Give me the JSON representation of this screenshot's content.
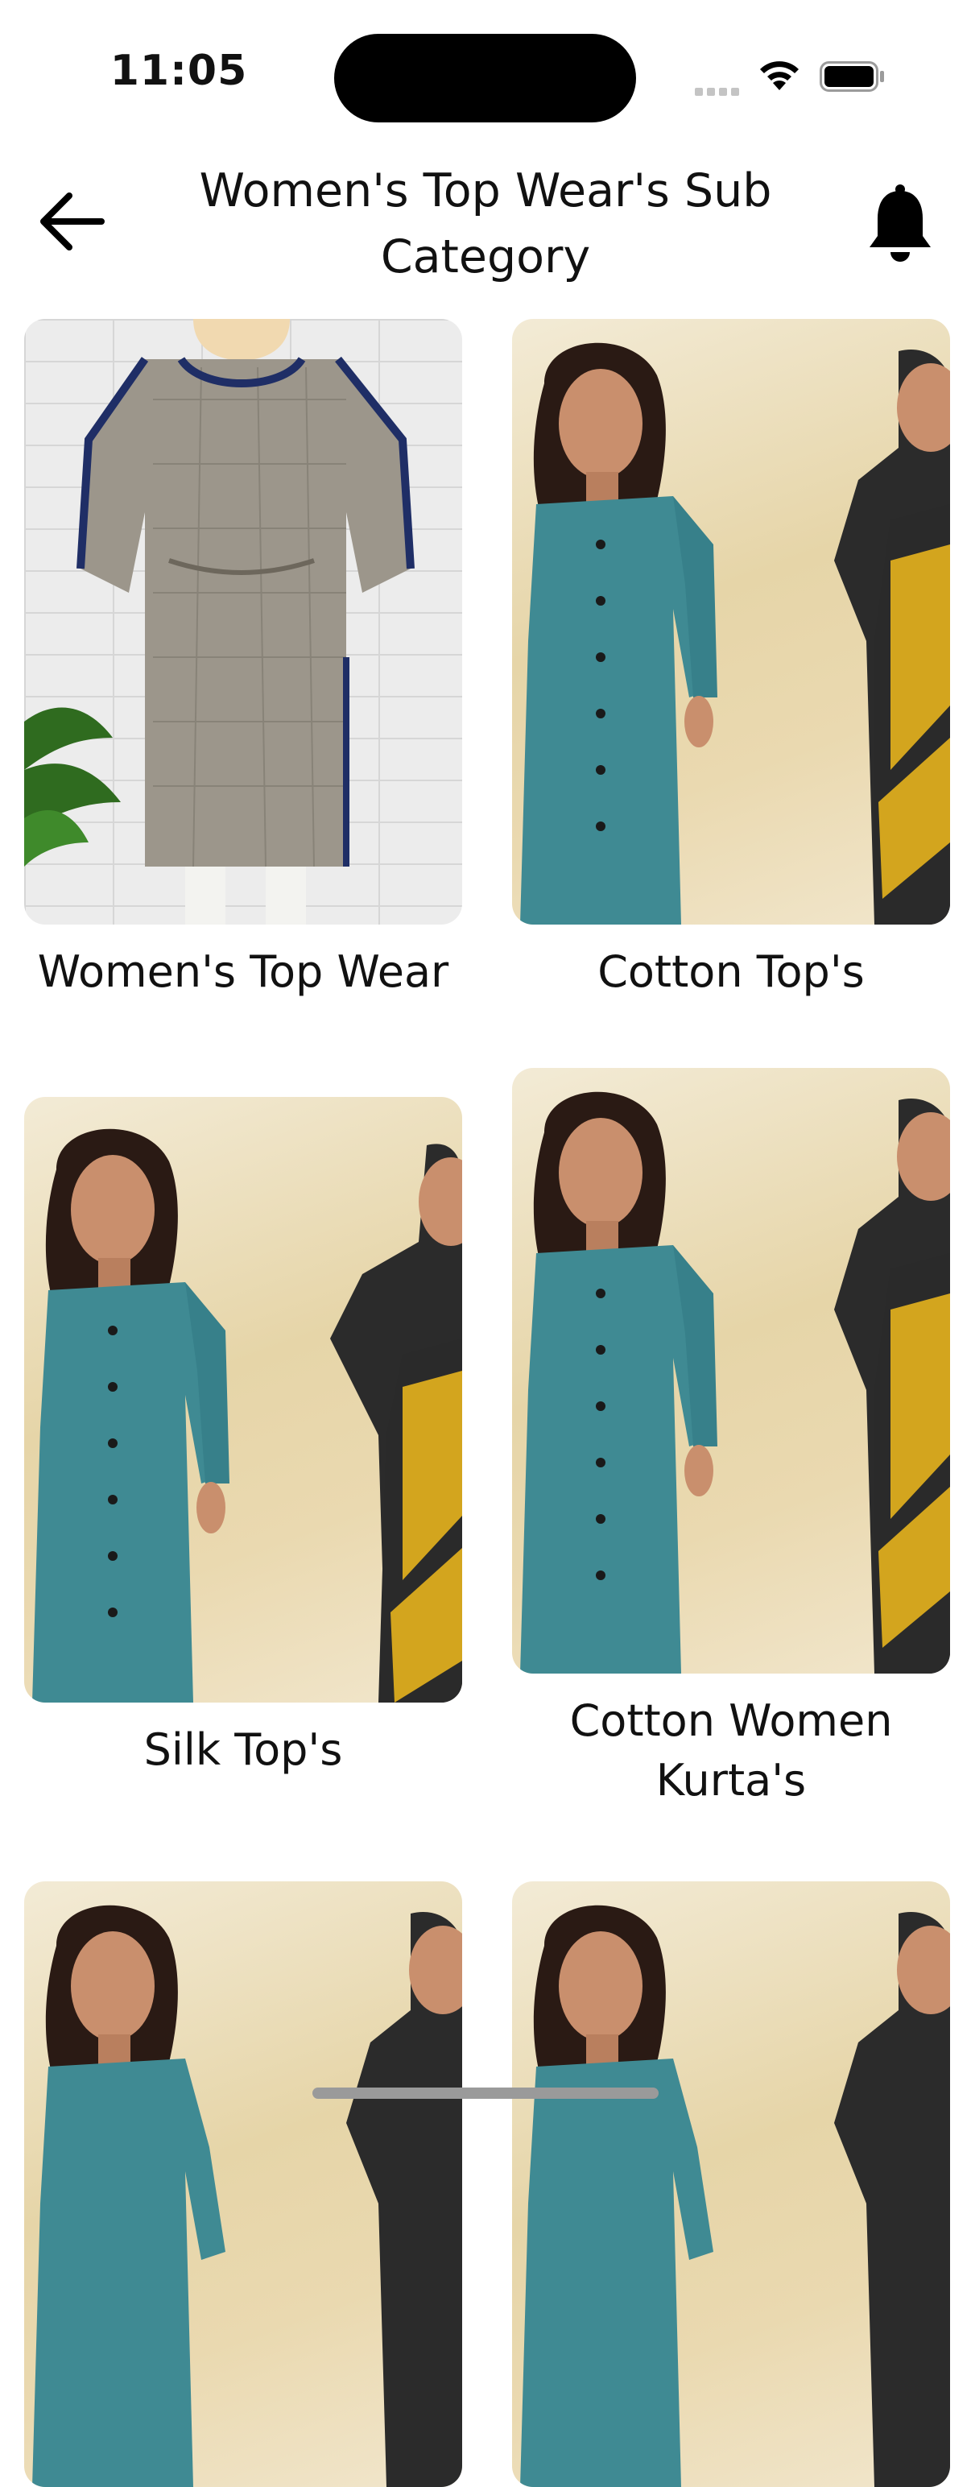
{
  "status_bar": {
    "time": "11:05"
  },
  "header": {
    "title": "Women's Top Wear's Sub Category",
    "back_icon": "arrow-left-icon",
    "notification_icon": "bell-icon"
  },
  "categories": [
    {
      "label": "Women's Top Wear",
      "image": "kaftan-photo"
    },
    {
      "label": "Cotton Top's",
      "image": "teal-kurta-model-photo"
    },
    {
      "label": "Silk Top's",
      "image": "teal-kurta-model-photo"
    },
    {
      "label": "Cotton Women Kurta's",
      "image": "teal-kurta-model-photo"
    },
    {
      "label": "",
      "image": "teal-kurta-model-photo"
    },
    {
      "label": "",
      "image": "teal-kurta-model-photo"
    }
  ],
  "colors": {
    "background": "#ffffff",
    "text": "#111111",
    "kurta_teal": "#3f8a93",
    "saree_yellow": "#e5b21d"
  }
}
